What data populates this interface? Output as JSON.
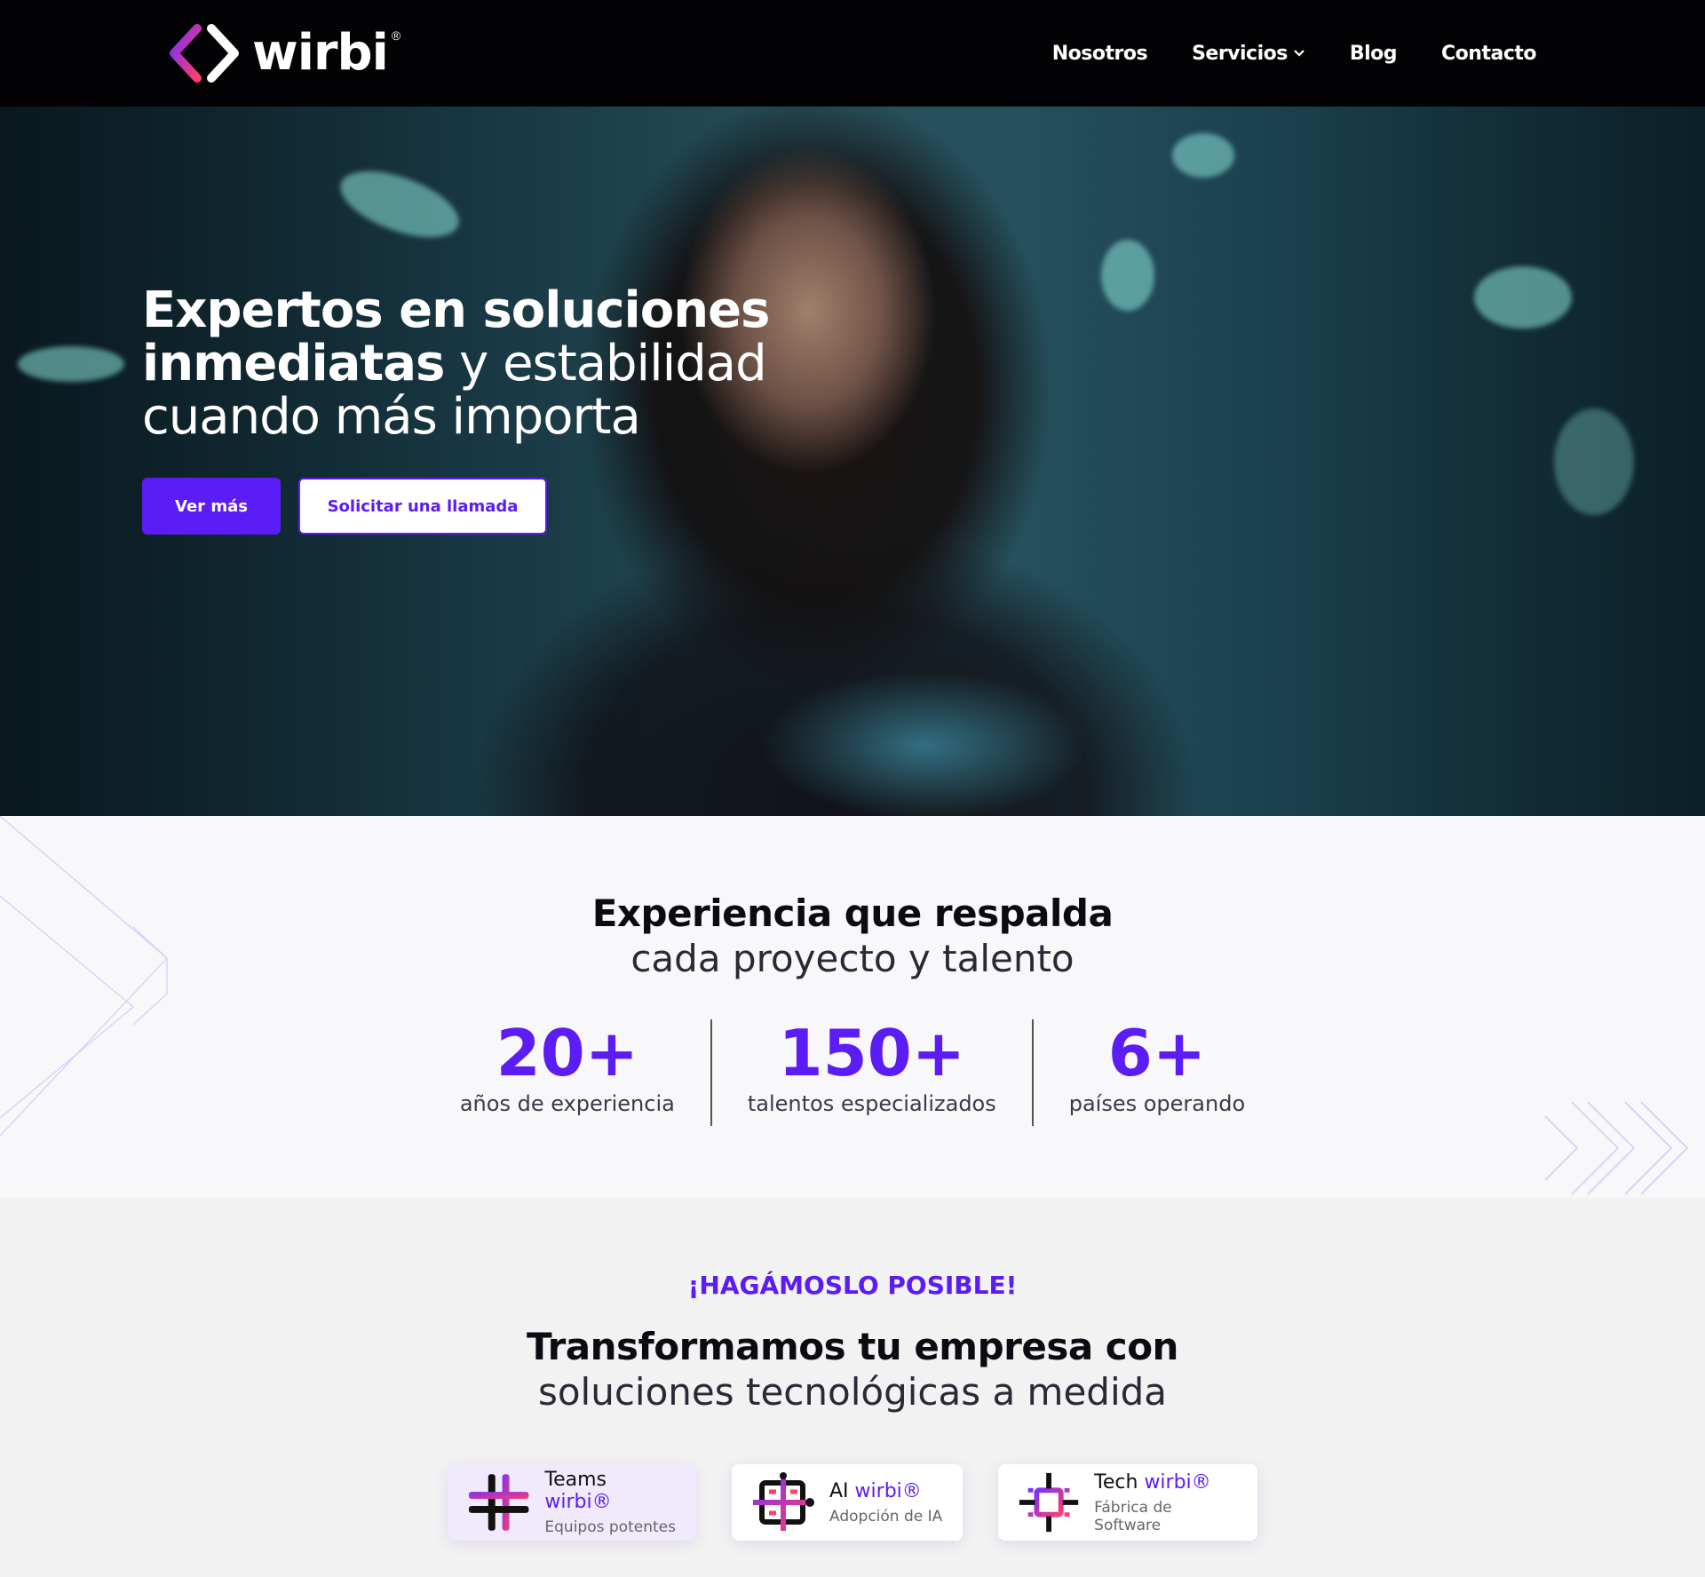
{
  "nav": {
    "brand": "wirbi",
    "reg": "®",
    "items": [
      {
        "label": "Nosotros"
      },
      {
        "label": "Servicios"
      },
      {
        "label": "Blog"
      },
      {
        "label": "Contacto"
      }
    ]
  },
  "hero": {
    "title_bold_1": "Expertos en soluciones",
    "title_bold_2": "inmediatas",
    "title_light_2": " y estabilidad",
    "title_light_3": "cuando más importa",
    "primary_cta": "Ver más",
    "secondary_cta": "Solicitar una llamada"
  },
  "stats": {
    "heading_strong": "Experiencia que respalda",
    "heading_light": "cada proyecto y talento",
    "items": [
      {
        "value": "20+",
        "label": "años de experiencia"
      },
      {
        "value": "150+",
        "label": "talentos especializados"
      },
      {
        "value": "6+",
        "label": "países operando"
      }
    ]
  },
  "services": {
    "eyebrow": "¡HAGÁMOSLO POSIBLE!",
    "heading_strong": "Transformamos tu empresa con",
    "heading_light": "soluciones tecnológicas a medida",
    "cards": [
      {
        "title": "Teams",
        "brand": "wirbi",
        "reg": "®",
        "subtitle": "Equipos potentes",
        "icon": "teams-icon"
      },
      {
        "title": "AI",
        "brand": "wirbi",
        "reg": "®",
        "subtitle": "Adopción de IA",
        "icon": "ai-icon"
      },
      {
        "title": "Tech",
        "brand": "wirbi",
        "reg": "®",
        "subtitle": "Fábrica de Software",
        "icon": "tech-icon"
      }
    ]
  },
  "colors": {
    "accent": "#5b1cf5",
    "nav_bg": "#030305"
  }
}
